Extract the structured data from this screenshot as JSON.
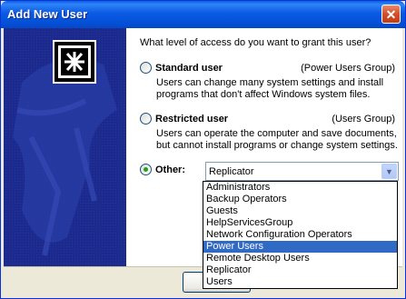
{
  "window": {
    "title": "Add New User",
    "close_glyph": "✕"
  },
  "question": "What level of access do you want to grant this user?",
  "options": {
    "standard": {
      "label": "Standard user",
      "group": "(Power Users Group)",
      "description": "Users can change many system settings and install programs that don't affect Windows system files."
    },
    "restricted": {
      "label": "Restricted user",
      "group": "(Users Group)",
      "description": "Users can operate the computer and save documents, but cannot install programs or change system settings."
    },
    "other": {
      "label": "Other:",
      "selected_value": "Replicator"
    }
  },
  "dropdown": {
    "items": [
      "Administrators",
      "Backup Operators",
      "Guests",
      "HelpServicesGroup",
      "Network Configuration Operators",
      "Power Users",
      "Remote Desktop Users",
      "Replicator",
      "Users"
    ],
    "highlighted_index": 5
  },
  "footer": {
    "button_partial": "<"
  },
  "icons": {
    "close": "close-icon",
    "dropdown": "chevron-down-icon",
    "user_key": "user-key-icon"
  },
  "colors": {
    "titlebar": "#0a5fe5",
    "side_panel": "#1c2a8e",
    "selection": "#316ac5"
  }
}
